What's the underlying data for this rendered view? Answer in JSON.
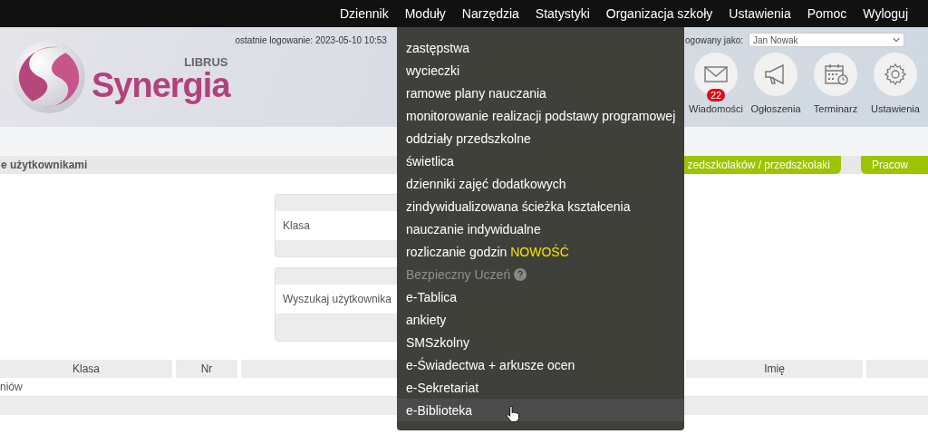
{
  "top_nav": [
    {
      "label": "Dziennik"
    },
    {
      "label": "Moduły"
    },
    {
      "label": "Narzędzia"
    },
    {
      "label": "Statystyki"
    },
    {
      "label": "Organizacja szkoły"
    },
    {
      "label": "Ustawienia"
    },
    {
      "label": "Pomoc"
    },
    {
      "label": "Wyloguj"
    }
  ],
  "logo": {
    "brand": "LIBRUS",
    "name": "Synergia"
  },
  "login_info": {
    "last_login": "ostatnie logowanie: 2023-05-10 10:53",
    "logged_as_tail": "ogowany jako:",
    "user": "Jan Nowak"
  },
  "shortcuts": [
    {
      "kind": "mail",
      "label": "Wiadomości",
      "badge": "22"
    },
    {
      "kind": "megaphone",
      "label": "Ogłoszenia"
    },
    {
      "kind": "calendar",
      "label": "Terminarz"
    },
    {
      "kind": "gear",
      "label": "Ustawienia"
    }
  ],
  "section_title": "e użytkownikami",
  "tabs": [
    {
      "label": "zedszkolaków / przedszkolaki"
    },
    {
      "label": "Pracow"
    }
  ],
  "filters": [
    {
      "label": "Klasa"
    },
    {
      "label": "Wyszukaj użytkownika"
    }
  ],
  "table": {
    "columns": [
      "Klasa",
      "Nr",
      "",
      "Imię",
      ""
    ],
    "rows": [
      [
        "niów"
      ]
    ]
  },
  "modules_menu": [
    {
      "label": "zastępstwa",
      "kind": "link",
      "highlighted": false
    },
    {
      "label": "wycieczki",
      "kind": "link",
      "highlighted": false
    },
    {
      "label": "ramowe plany nauczania",
      "kind": "link",
      "highlighted": false
    },
    {
      "label": "monitorowanie realizacji podstawy programowej",
      "kind": "link",
      "highlighted": false
    },
    {
      "label": "oddziały przedszkolne",
      "kind": "link",
      "highlighted": false
    },
    {
      "label": "świetlica",
      "kind": "link",
      "highlighted": false
    },
    {
      "label": "dzienniki zajęć dodatkowych",
      "kind": "link",
      "highlighted": false
    },
    {
      "label": "zindywidualizowana ścieżka kształcenia",
      "kind": "link",
      "highlighted": false
    },
    {
      "label": "nauczanie indywidualne",
      "kind": "link",
      "highlighted": false
    },
    {
      "label": "rozliczanie godzin",
      "kind": "link",
      "badge": "NOWOŚĆ",
      "highlighted": false
    },
    {
      "label": "Bezpieczny Uczeń",
      "kind": "disabled",
      "highlighted": false
    },
    {
      "label": "e-Tablica",
      "kind": "link",
      "highlighted": false
    },
    {
      "label": "ankiety",
      "kind": "link",
      "highlighted": false
    },
    {
      "label": "SMSzkolny",
      "kind": "link",
      "highlighted": false
    },
    {
      "label": "e-Świadectwa + arkusze ocen",
      "kind": "link",
      "highlighted": false
    },
    {
      "label": "e-Sekretariat",
      "kind": "link",
      "highlighted": false
    },
    {
      "label": "e-Biblioteka",
      "kind": "link",
      "highlighted": true
    }
  ]
}
